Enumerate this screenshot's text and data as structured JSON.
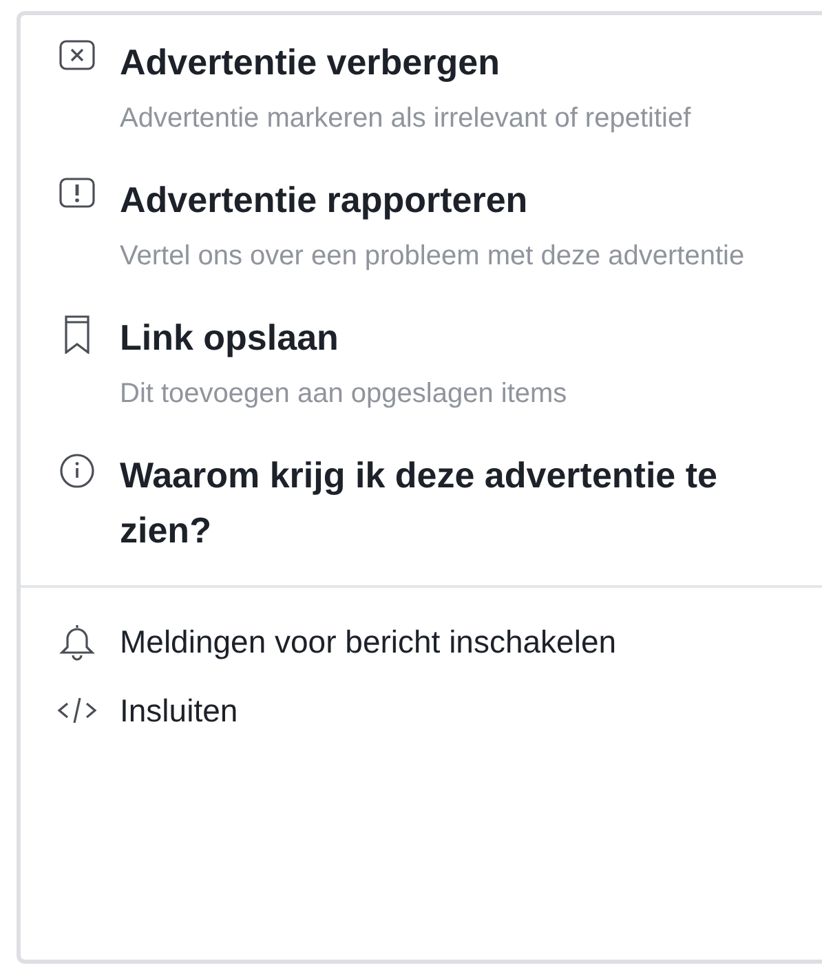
{
  "menu": {
    "sections": [
      {
        "items": [
          {
            "title": "Advertentie verbergen",
            "description": "Advertentie markeren als irrelevant of repetitief"
          },
          {
            "title": "Advertentie rapporteren",
            "description": "Vertel ons over een probleem met deze advertentie"
          },
          {
            "title": "Link opslaan",
            "description": "Dit toevoegen aan opgeslagen items"
          },
          {
            "title": "Waarom krijg ik deze advertentie te zien?"
          }
        ]
      },
      {
        "items": [
          {
            "title": "Meldingen voor bericht inschakelen"
          },
          {
            "title": "Insluiten"
          }
        ]
      }
    ]
  }
}
